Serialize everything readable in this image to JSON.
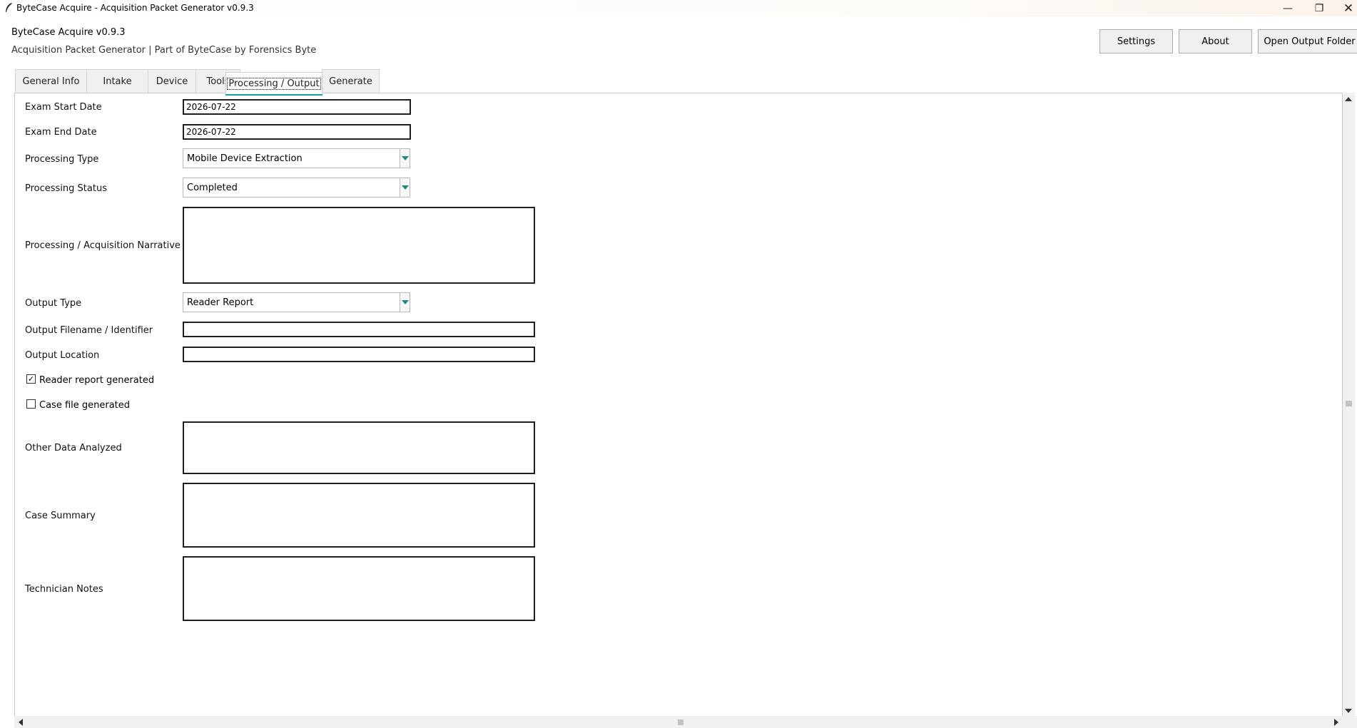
{
  "window": {
    "title": "ByteCase Acquire - Acquisition Packet Generator v0.9.3",
    "minimize_glyph": "—",
    "maximize_glyph": "❐",
    "close_glyph": "✕"
  },
  "header": {
    "app_version": "ByteCase Acquire v0.9.3",
    "subtitle": "Acquisition Packet Generator | Part of ByteCase by Forensics Byte",
    "buttons": {
      "settings": "Settings",
      "about": "About",
      "open_output": "Open Output Folder"
    }
  },
  "tabs": [
    {
      "label": "General Info"
    },
    {
      "label": "Intake"
    },
    {
      "label": "Device"
    },
    {
      "label": "Tools"
    },
    {
      "label": "Processing / Output",
      "active": true
    },
    {
      "label": "Generate"
    }
  ],
  "form": {
    "exam_start_date": {
      "label": "Exam Start Date",
      "value": "2026-07-22"
    },
    "exam_end_date": {
      "label": "Exam End Date",
      "value": "2026-07-22"
    },
    "processing_type": {
      "label": "Processing Type",
      "value": "Mobile Device Extraction"
    },
    "processing_status": {
      "label": "Processing Status",
      "value": "Completed"
    },
    "narrative": {
      "label": "Processing / Acquisition Narrative",
      "value": ""
    },
    "output_type": {
      "label": "Output Type",
      "value": "Reader Report"
    },
    "output_filename": {
      "label": "Output Filename / Identifier",
      "value": ""
    },
    "output_location": {
      "label": "Output Location",
      "value": ""
    },
    "reader_report_generated": {
      "label": "Reader report generated",
      "checked": true,
      "mark": "✓"
    },
    "case_file_generated": {
      "label": "Case file generated",
      "checked": false,
      "mark": ""
    },
    "other_data_analyzed": {
      "label": "Other Data Analyzed",
      "value": ""
    },
    "case_summary": {
      "label": "Case Summary",
      "value": ""
    },
    "technician_notes": {
      "label": "Technician Notes",
      "value": ""
    }
  },
  "colors": {
    "accent": "#1aa3a3",
    "combo_arrow": "#178e80",
    "field_border": "#1f1f1f"
  }
}
